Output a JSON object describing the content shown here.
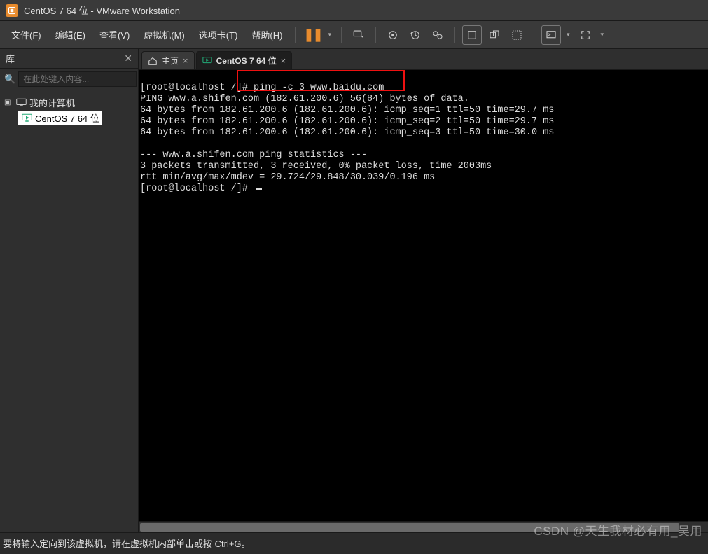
{
  "window": {
    "title": "CentOS 7 64 位 - VMware Workstation"
  },
  "menu": {
    "items": [
      {
        "label": "文件(F)"
      },
      {
        "label": "编辑(E)"
      },
      {
        "label": "查看(V)"
      },
      {
        "label": "虚拟机(M)"
      },
      {
        "label": "选项卡(T)"
      },
      {
        "label": "帮助(H)"
      }
    ]
  },
  "sidebar": {
    "title": "库",
    "search_placeholder": "在此处键入内容...",
    "root_label": "我的计算机",
    "vm_label": "CentOS 7 64 位"
  },
  "tabs": {
    "home": "主页",
    "vm": "CentOS 7 64 位"
  },
  "terminal": {
    "line1_prompt": "[root@localhost /]# ",
    "line1_cmd": "ping -c 3 www.baidu.com",
    "line2": "PING www.a.shifen.com (182.61.200.6) 56(84) bytes of data.",
    "line3": "64 bytes from 182.61.200.6 (182.61.200.6): icmp_seq=1 ttl=50 time=29.7 ms",
    "line4": "64 bytes from 182.61.200.6 (182.61.200.6): icmp_seq=2 ttl=50 time=29.7 ms",
    "line5": "64 bytes from 182.61.200.6 (182.61.200.6): icmp_seq=3 ttl=50 time=30.0 ms",
    "blank": "",
    "line6": "--- www.a.shifen.com ping statistics ---",
    "line7": "3 packets transmitted, 3 received, 0% packet loss, time 2003ms",
    "line8": "rtt min/avg/max/mdev = 29.724/29.848/30.039/0.196 ms",
    "line9": "[root@localhost /]# "
  },
  "statusbar": {
    "text": "要将输入定向到该虚拟机，请在虚拟机内部单击或按 Ctrl+G。"
  },
  "watermark": "CSDN @天生我材必有用_吴用",
  "icons": {
    "pause": "❚❚"
  }
}
